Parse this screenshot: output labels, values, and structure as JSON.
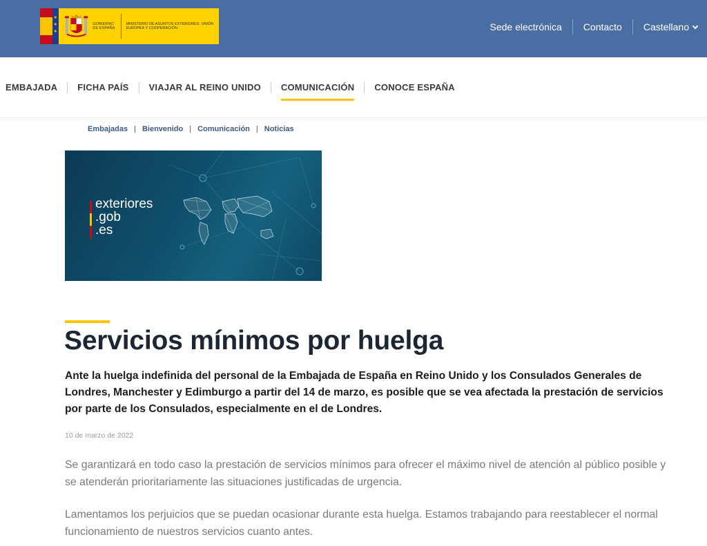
{
  "header": {
    "logo": {
      "gov_text": "GOBIERNO DE ESPAÑA",
      "ministry_text": "MINISTERIO DE ASUNTOS EXTERIORES, UNIÓN EUROPEA Y COOPERACIÓN"
    },
    "links": [
      "Sede electrónica",
      "Contacto"
    ],
    "language": "Castellano"
  },
  "nav": {
    "items": [
      "EMBAJADA",
      "FICHA PAÍS",
      "VIAJAR AL REINO UNIDO",
      "COMUNICACIÓN",
      "CONOCE ESPAÑA"
    ],
    "active": "COMUNICACIÓN"
  },
  "breadcrumb": [
    "Embajadas",
    "Bienvenido",
    "Comunicación",
    "Noticias"
  ],
  "banner": {
    "line1": "exteriores",
    "line2": ".gob",
    "line3": ".es"
  },
  "article": {
    "title": "Servicios mínimos por huelga",
    "lead": "Ante la huelga indefinida del personal de la Embajada de España en Reino Unido y los Consulados Generales de Londres, Manchester y Edimburgo a partir del 14 de marzo, es posible que se vea afectada la prestación de servicios por parte de los Consulados, especialmente en el de Londres.",
    "date": "10 de marzo de 2022",
    "paragraphs": [
      "Se garantizará en todo caso la prestación de servicios mínimos para ofrecer el máximo nivel de atención al público posible y se atenderán prioritariamente las situaciones justificadas de urgencia.",
      "Lamentamos los perjuicios que se puedan ocasionar durante esta huelga. Estamos trabajando para reestablecer el normal funcionamiento de nuestros servicios cuanto antes."
    ]
  },
  "colors": {
    "header_blue": "#4a6ea3",
    "accent_yellow": "#ffc400",
    "breadcrumb_blue": "#3d5a80"
  }
}
